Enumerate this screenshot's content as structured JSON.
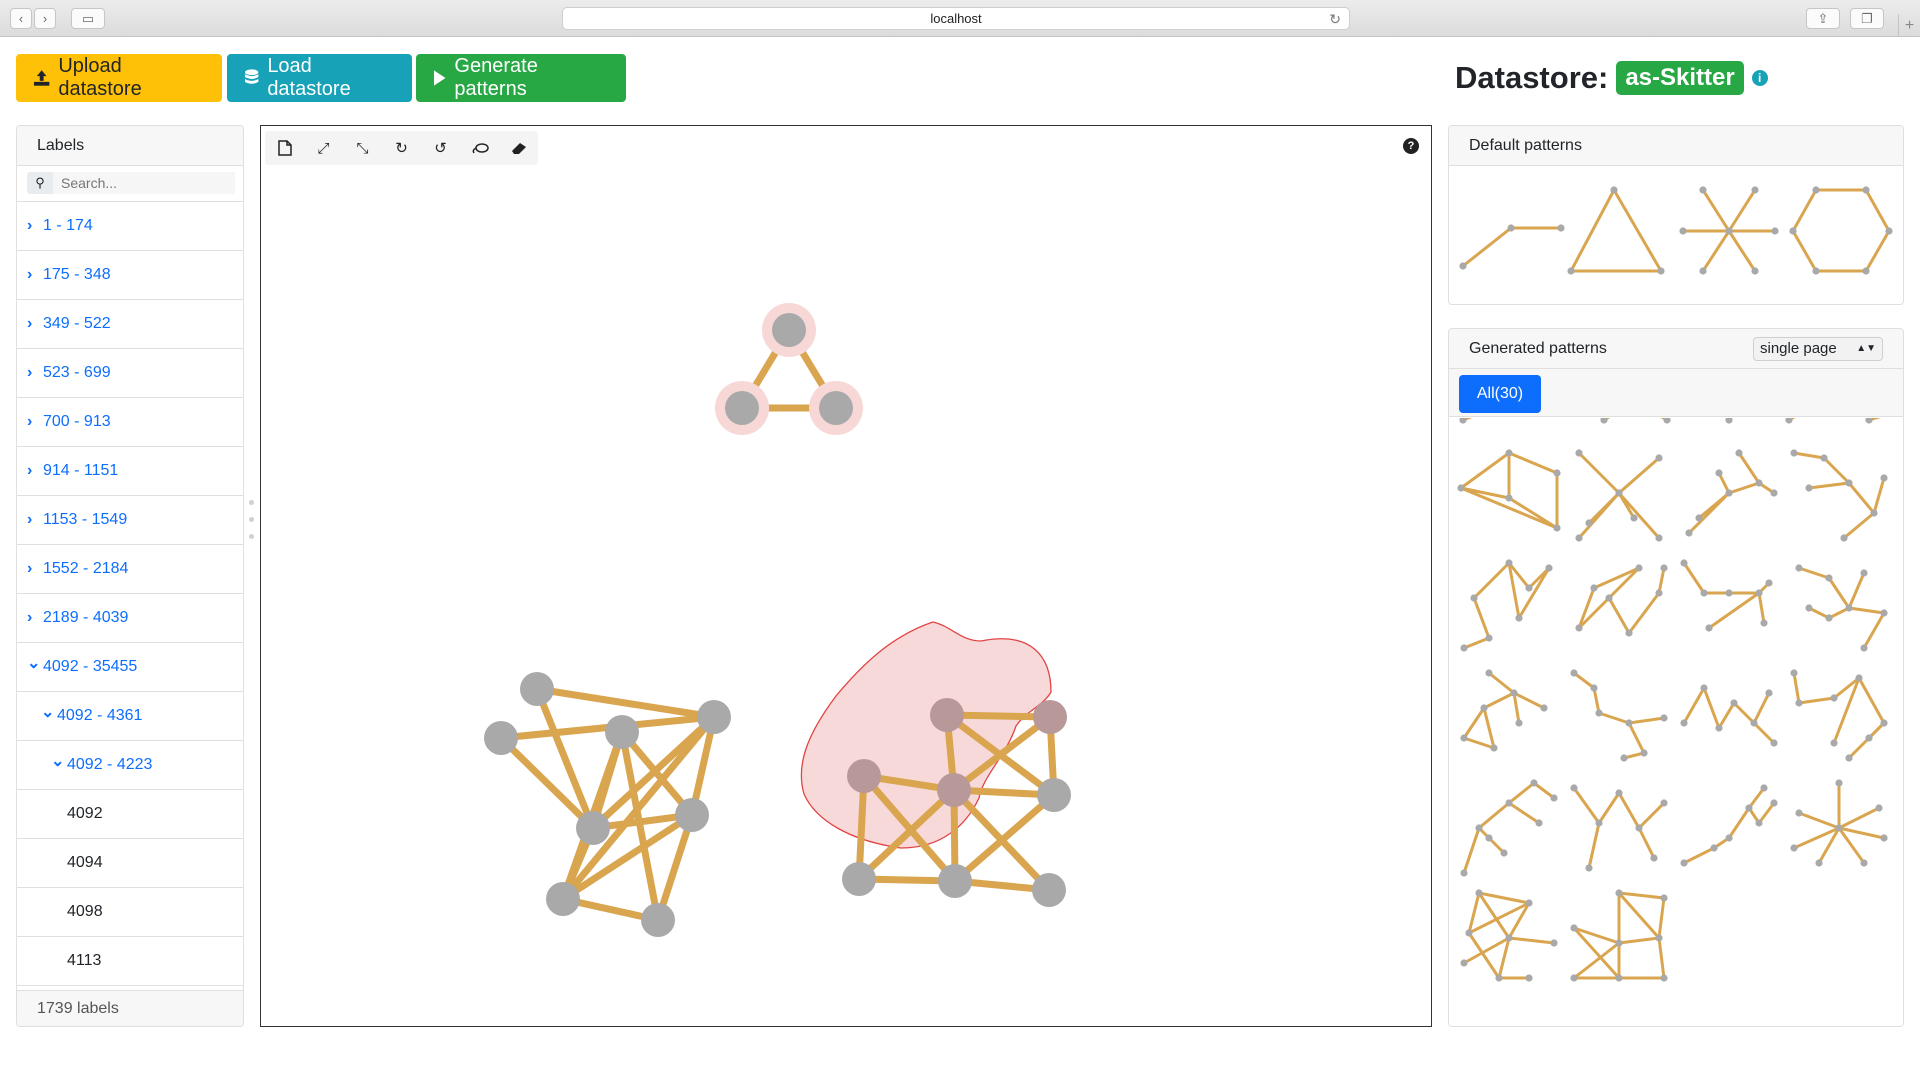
{
  "browser": {
    "url": "localhost",
    "back_icon": "chevron-left",
    "forward_icon": "chevron-right",
    "sidebar_icon": "sidebar",
    "share_icon": "share",
    "tabs_icon": "tabs"
  },
  "toolbar": {
    "upload_label": "Upload datastore",
    "load_label": "Load datastore",
    "generate_label": "Generate patterns"
  },
  "datastore": {
    "label": "Datastore:",
    "name": "as-Skitter"
  },
  "labels_panel": {
    "title": "Labels",
    "search_placeholder": "Search...",
    "items": [
      {
        "label": "1 - 174",
        "state": "collapsed",
        "level": 0
      },
      {
        "label": "175 - 348",
        "state": "collapsed",
        "level": 0
      },
      {
        "label": "349 - 522",
        "state": "collapsed",
        "level": 0
      },
      {
        "label": "523 - 699",
        "state": "collapsed",
        "level": 0
      },
      {
        "label": "700 - 913",
        "state": "collapsed",
        "level": 0
      },
      {
        "label": "914 - 1151",
        "state": "collapsed",
        "level": 0
      },
      {
        "label": "1153 - 1549",
        "state": "collapsed",
        "level": 0
      },
      {
        "label": "1552 - 2184",
        "state": "collapsed",
        "level": 0
      },
      {
        "label": "2189 - 4039",
        "state": "collapsed",
        "level": 0
      },
      {
        "label": "4092 - 35455",
        "state": "expanded",
        "level": 0
      },
      {
        "label": "4092 - 4361",
        "state": "expanded",
        "level": 1
      },
      {
        "label": "4092 - 4223",
        "state": "expanded",
        "level": 2
      },
      {
        "label": "4092",
        "state": "leaf",
        "level": 3
      },
      {
        "label": "4094",
        "state": "leaf",
        "level": 3
      },
      {
        "label": "4098",
        "state": "leaf",
        "level": 3
      },
      {
        "label": "4113",
        "state": "leaf",
        "level": 3
      }
    ],
    "footer": "1739 labels"
  },
  "canvas_tools": [
    "new-icon",
    "expand-icon",
    "compress-icon",
    "redo-icon",
    "undo-icon",
    "lasso-icon",
    "eraser-icon"
  ],
  "default_patterns": {
    "title": "Default patterns"
  },
  "generated_patterns": {
    "title": "Generated patterns",
    "view_mode": "single page",
    "filter_label": "All(30)"
  },
  "colors": {
    "edge": "#d9a54f",
    "node": "#a9a9a9",
    "highlight": "#f8d7d7",
    "lasso": "#e03a3a",
    "primary": "#0d6efd",
    "success": "#28a745",
    "info": "#17a2b8",
    "warning": "#ffc107"
  }
}
